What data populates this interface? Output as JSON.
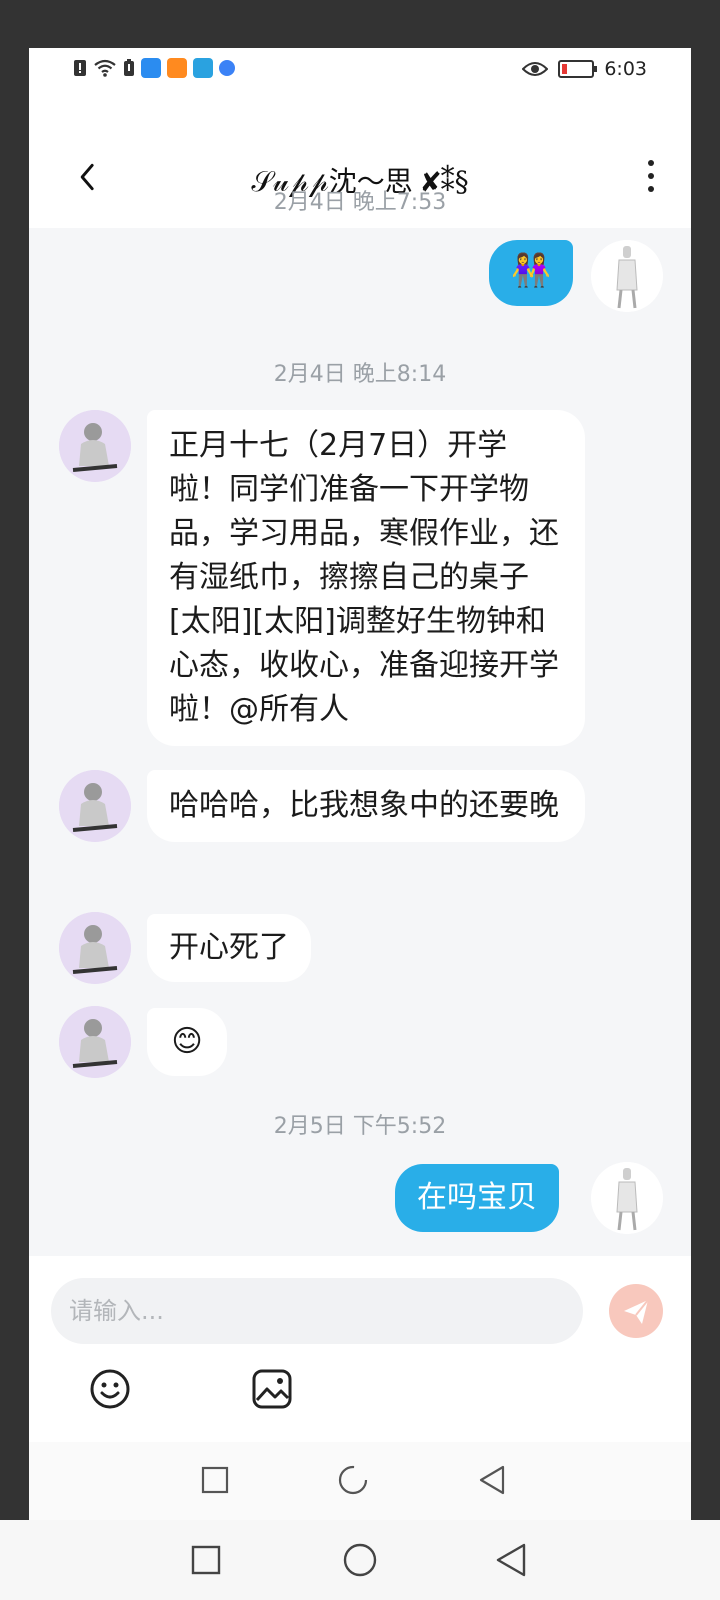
{
  "status_bar": {
    "time": "6:03",
    "icons": [
      "alert-icon",
      "wifi-icon",
      "sim-icon",
      "search-app-icon",
      "video-app-icon",
      "book-app-icon",
      "browser-app-icon",
      "eye-icon",
      "battery-icon"
    ],
    "battery_level": 0.1,
    "battery_color": "#e53935"
  },
  "header": {
    "title": "𝒮𝓊𝓅𝓅沈～思 ✘⁑§",
    "back_icon": "chevron-left-icon",
    "more_icon": "more-vertical-icon"
  },
  "messages": {
    "t1": "2月4日 晚上7:53",
    "m1_emoji": "👭",
    "t2": "2月4日 晚上8:14",
    "m2": "正月十七（2月7日）开学啦！同学们准备一下开学物品，学习用品，寒假作业，还有湿纸巾，擦擦自己的桌子[太阳][太阳]调整好生物钟和心态，收收心，准备迎接开学啦！@所有人",
    "m3": "哈哈哈，比我想象中的还要晚",
    "m4": "开心死了",
    "m5_emoji": "😊",
    "t3": "2月5日 下午5:52",
    "m6": "在吗宝贝"
  },
  "input": {
    "placeholder": "请输入..."
  },
  "toolbar": {
    "emoji_icon": "smiley-icon",
    "image_icon": "image-icon",
    "send_icon": "send-icon"
  },
  "colors": {
    "outgoing_bubble": "#29aee8",
    "incoming_bubble": "#ffffff",
    "background": "#f5f6f8",
    "send_button": "#f8c8bd"
  },
  "nav": {
    "icons": [
      "recent-apps-icon",
      "home-icon",
      "back-icon"
    ]
  }
}
